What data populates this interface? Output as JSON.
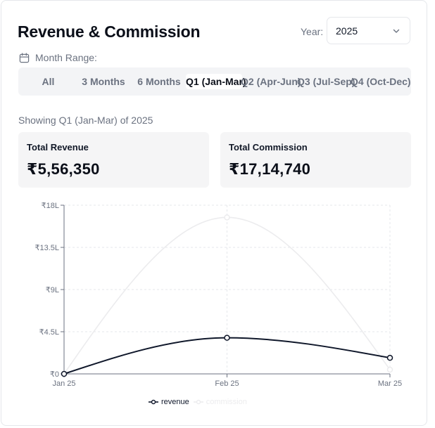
{
  "header": {
    "title": "Revenue & Commission",
    "year_label": "Year:",
    "year_value": "2025"
  },
  "icons": {
    "calendar": "calendar-icon",
    "chevron": "chevron-down-icon"
  },
  "month_range": {
    "label": "Month Range:",
    "tabs": [
      "All",
      "3 Months",
      "6 Months",
      "Q1 (Jan-Mar)",
      "Q2 (Apr-Jun)",
      "Q3 (Jul-Sep)",
      "Q4 (Oct-Dec)"
    ],
    "active_index": 3
  },
  "showing_text": "Showing Q1 (Jan-Mar) of 2025",
  "stats": {
    "revenue": {
      "label": "Total Revenue",
      "value": "₹5,56,350"
    },
    "commission": {
      "label": "Total Commission",
      "value": "₹17,14,740"
    }
  },
  "colors": {
    "revenue": "#0f172a",
    "commission": "#ececee",
    "grid": "#e5e7eb",
    "axis": "#6b7280"
  },
  "chart_data": {
    "type": "line",
    "x": [
      "Jan 25",
      "Feb 25",
      "Mar 25"
    ],
    "y_ticks": [
      "₹0",
      "₹4.5L",
      "₹9L",
      "₹13.5L",
      "₹18L"
    ],
    "ylim": [
      0,
      1800000
    ],
    "grid": true,
    "curve": "smooth",
    "legend_position": "bottom-center",
    "series": [
      {
        "name": "revenue",
        "values": [
          0,
          385000,
          171350
        ]
      },
      {
        "name": "commission",
        "values": [
          0,
          1670000,
          44740
        ]
      }
    ]
  }
}
